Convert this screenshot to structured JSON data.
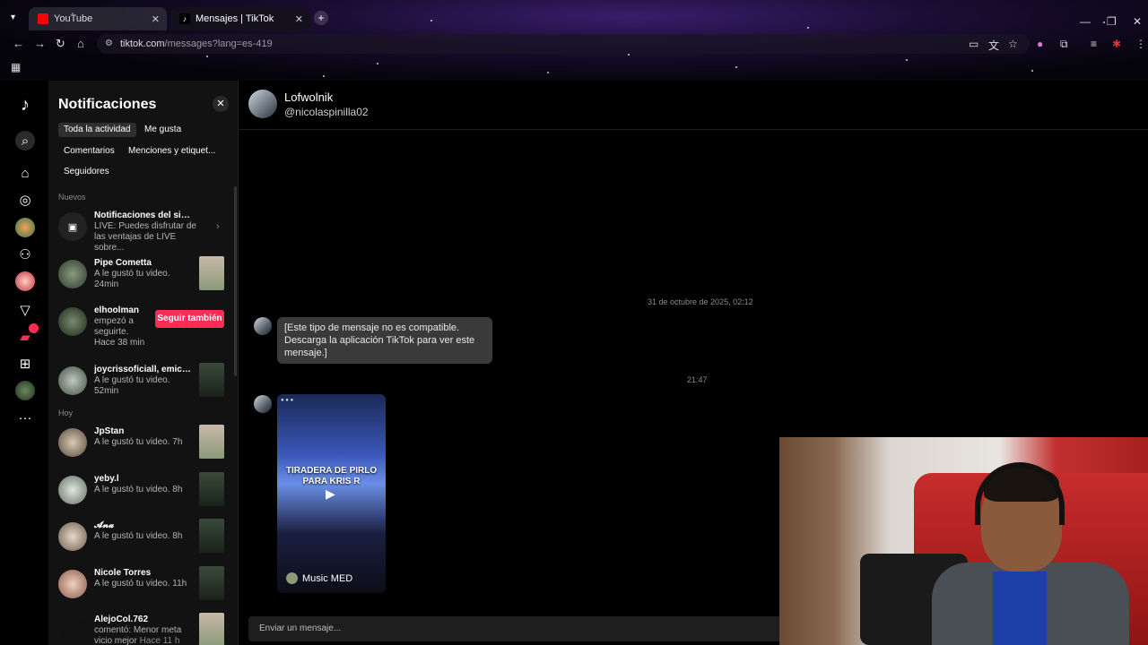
{
  "browser": {
    "tabs": [
      {
        "title": "YouTube",
        "active": false
      },
      {
        "title": "Mensajes | TikTok",
        "active": true
      }
    ],
    "url_host": "tiktok.com",
    "url_path": "/messages?lang=es-419"
  },
  "notifications": {
    "title": "Notificaciones",
    "filters": [
      "Toda la actividad",
      "Me gusta",
      "Comentarios",
      "Menciones y etiquet...",
      "Seguidores"
    ],
    "section_new": "Nuevos",
    "section_today": "Hoy",
    "items": [
      {
        "name": "Notificaciones del sistema",
        "text": "LIVE: Puedes disfrutar de las ventajas de LIVE sobre...",
        "time": ""
      },
      {
        "name": "Pipe Cometta",
        "text": "A le gustó tu video.",
        "time": "24min"
      },
      {
        "name": "elhoolman",
        "text": "empezó a seguirte.",
        "time": "Hace 38 min"
      },
      {
        "name": "joycrissoficiall, emicast...",
        "text": "A le gustó tu video.",
        "time": "52min"
      },
      {
        "name": "JpStan",
        "text": "A le gustó tu video.",
        "time": "7h"
      },
      {
        "name": "yeby.l",
        "text": "A le gustó tu video.",
        "time": "8h"
      },
      {
        "name": "𝓐𝓷𝓪",
        "text": "A le gustó tu video.",
        "time": "8h"
      },
      {
        "name": "Nicole Torres",
        "text": "A le gustó tu video.",
        "time": "11h"
      },
      {
        "name": "AlejoCol.762",
        "text": "comentó: Menor meta vicio mejor",
        "time": "Hace 11 h"
      }
    ],
    "follow_back_label": "Seguir también"
  },
  "chat": {
    "display_name": "Lofwolnik",
    "username": "@nicolaspinilla02",
    "timestamp_1": "31 de octubre de 2025, 02:12",
    "message_1": "[Este tipo de mensaje no es compatible. Descarga la aplicación TikTok para ver este mensaje.]",
    "timestamp_2": "21:47",
    "video_caption": "TIRADERA DE PIRLO PARA KRIS R",
    "video_music": "Music MED",
    "input_placeholder": "Enviar un mensaje..."
  },
  "colors": {
    "accent": "#fe2c55",
    "panel_bg": "#121212",
    "bubble_bg": "#3a3a3a"
  }
}
